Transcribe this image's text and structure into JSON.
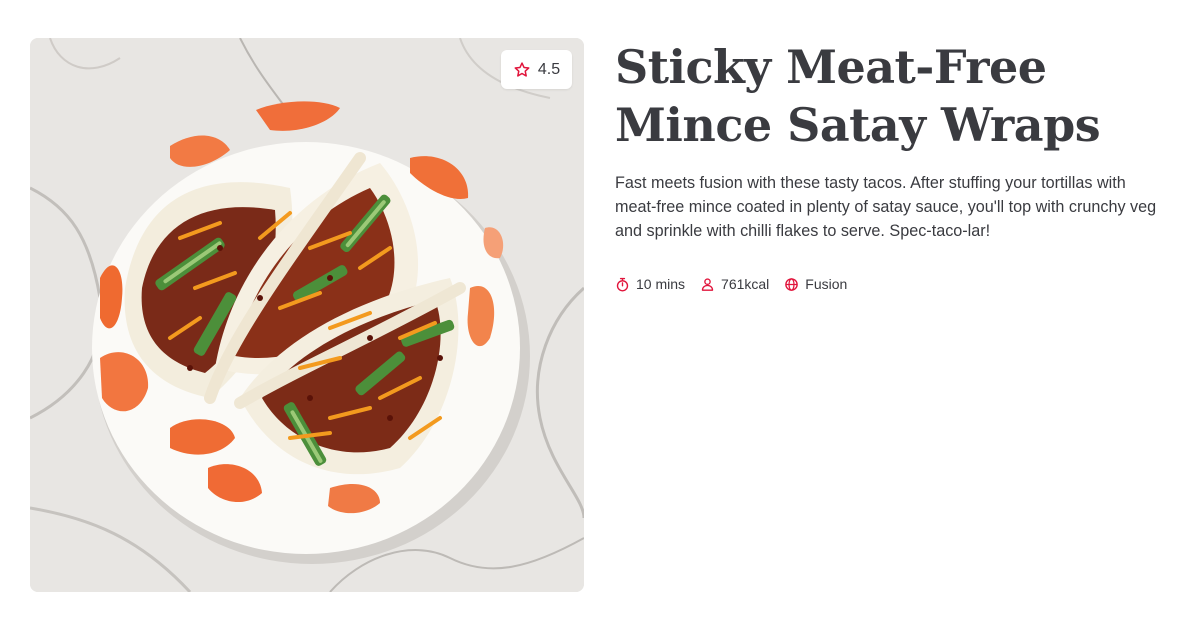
{
  "recipe": {
    "title": "Sticky Meat-Free Mince Satay Wraps",
    "description": "Fast meets fusion with these tasty tacos. After stuffing your tortillas with meat-free mince coated in plenty of satay sauce, you'll top with crunchy veg and sprinkle with chilli flakes to serve. Spec-taco-lar!",
    "rating": "4.5",
    "image_alt": "Tortilla wraps filled with meat-free mince, cucumber and grated carrot on a white plate with orange brush strokes on a marble surface",
    "meta": {
      "time": "10 mins",
      "calories": "761kcal",
      "cuisine": "Fusion"
    }
  },
  "icons": {
    "rating": "star-icon",
    "time": "stopwatch-icon",
    "calories": "person-icon",
    "cuisine": "globe-icon"
  },
  "colors": {
    "accent": "#e1153c",
    "text": "#3a3b40",
    "background": "#ffffff"
  }
}
